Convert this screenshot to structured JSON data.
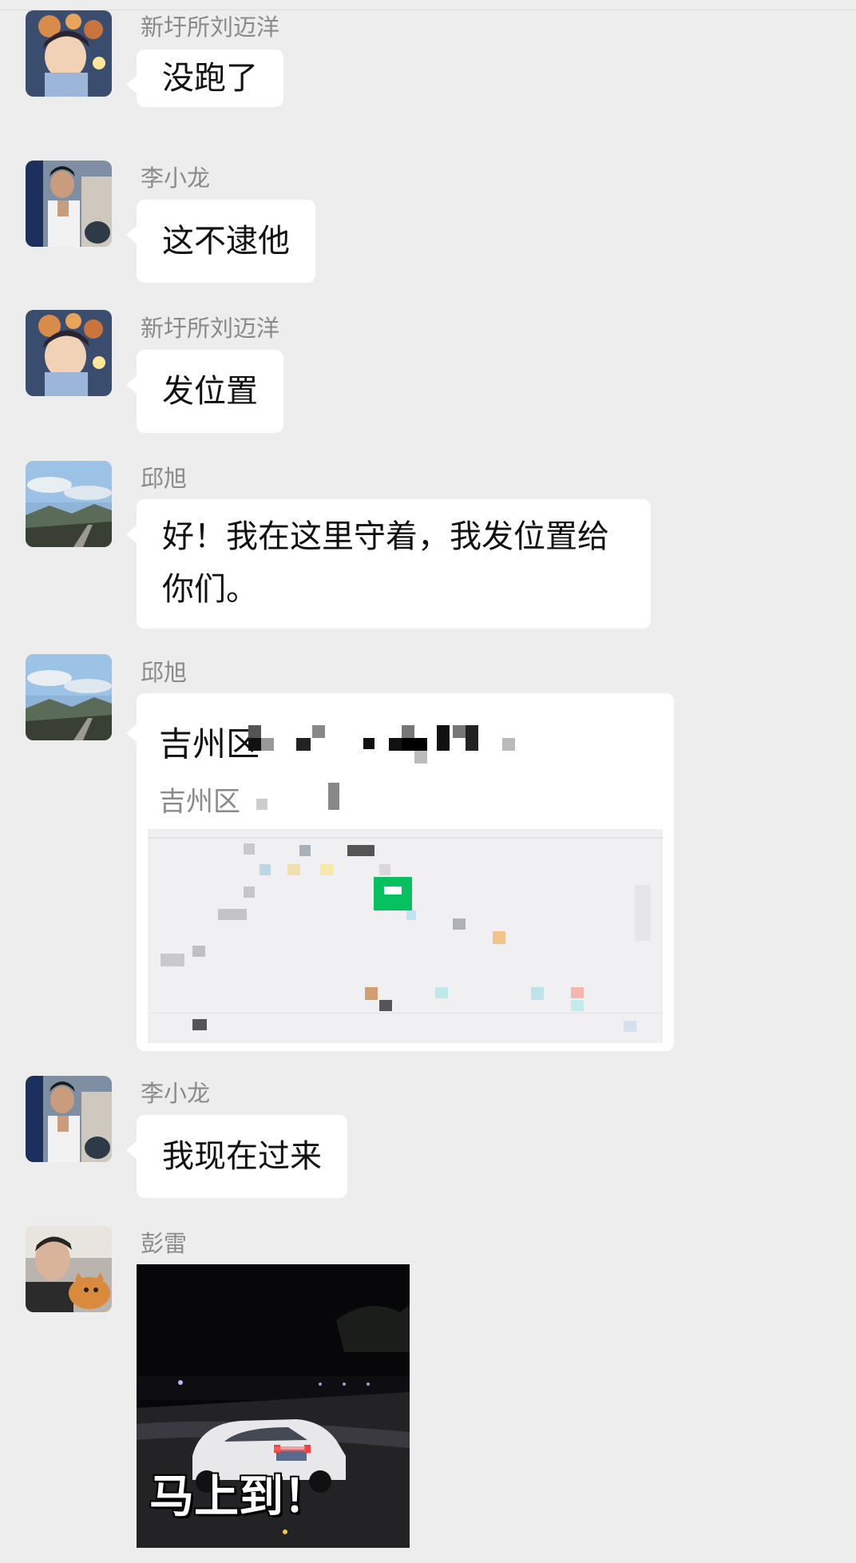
{
  "messages": [
    {
      "sender": "新圩所刘迈洋",
      "text": "没跑了"
    },
    {
      "sender": "李小龙",
      "text": "这不逮他"
    },
    {
      "sender": "新圩所刘迈洋",
      "text": "发位置"
    },
    {
      "sender": "邱旭",
      "text": "好！我在这里守着，我发位置给你们。"
    },
    {
      "sender": "邱旭",
      "location_title": "吉州区",
      "location_address": "吉州区"
    },
    {
      "sender": "李小龙",
      "text": "我现在过来"
    },
    {
      "sender": "彭雷",
      "video_caption": "马上到！"
    }
  ],
  "colors": {
    "background": "#ededed",
    "bubble": "#ffffff",
    "sender_text": "#8a8a8a",
    "map_marker": "#07c160"
  },
  "icons": [
    "avatar-anime-boy",
    "avatar-man",
    "avatar-landscape",
    "avatar-person-with-cat"
  ]
}
